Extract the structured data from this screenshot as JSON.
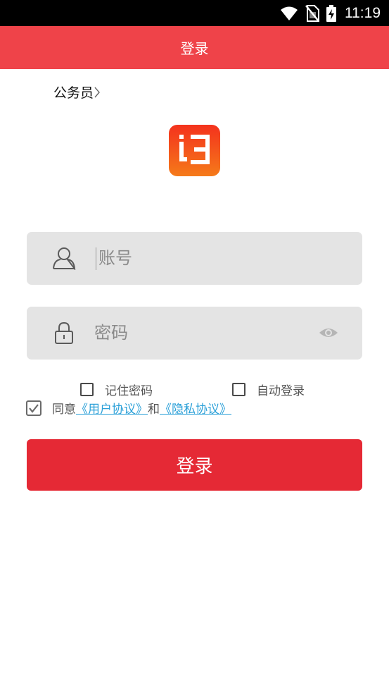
{
  "status_bar": {
    "time": "11:19",
    "icons": [
      "wifi-icon",
      "no-sim-icon",
      "battery-charging-icon"
    ]
  },
  "header": {
    "title": "登录",
    "background": "#ef4349"
  },
  "role_selector": {
    "label": "公务员",
    "icon": "chevron-right-icon"
  },
  "logo": {
    "icon": "app-logo-icon",
    "gradient": [
      "#f4321d",
      "#f57a1a"
    ]
  },
  "form": {
    "account": {
      "placeholder": "账号",
      "value": "",
      "icon": "user-icon"
    },
    "password": {
      "placeholder": "密码",
      "value": "",
      "icon": "lock-icon",
      "toggle_icon": "eye-icon"
    },
    "remember_password": {
      "label": "记住密码",
      "checked": false
    },
    "auto_login": {
      "label": "自动登录",
      "checked": false
    },
    "agreement": {
      "checked": true,
      "prefix": "同意",
      "user_agreement": "《用户协议》",
      "conjunction": "和",
      "privacy_policy": "《隐私协议》",
      "link_color": "#2ba0d8"
    },
    "submit_label": "登录",
    "submit_color": "#e52935"
  }
}
